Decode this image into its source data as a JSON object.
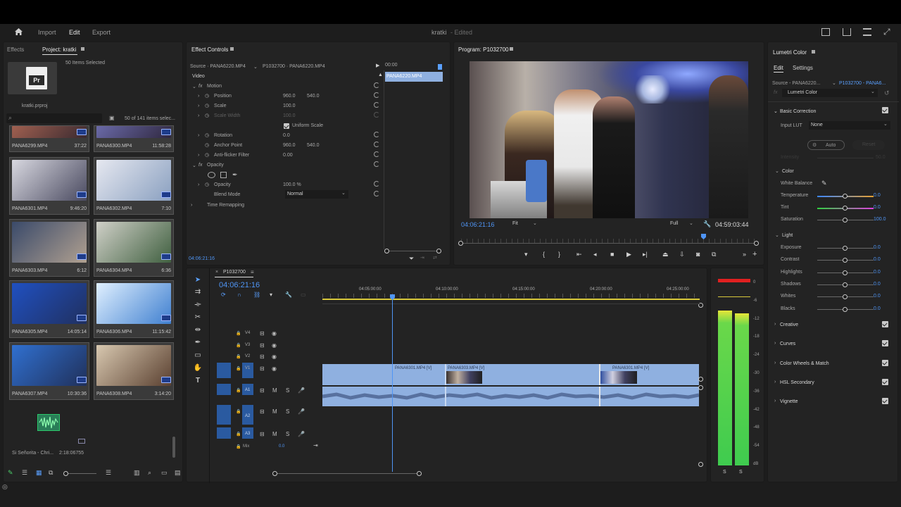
{
  "header": {
    "menu": [
      "Import",
      "Edit",
      "Export"
    ],
    "active": "Edit",
    "project_title": "kratki",
    "project_state": "- Edited"
  },
  "project_panel": {
    "tabs": [
      "Effects",
      "Project: kratki"
    ],
    "selection_info": "50 Items Selected",
    "project_file": "kratki.prproj",
    "items_count": "50 of 141 items selec...",
    "thumbs": [
      {
        "name": "PANA6299.MP4",
        "dur": "37:22",
        "c1": "#a06050",
        "c2": "#3a2a30"
      },
      {
        "name": "PANA6300.MP4",
        "dur": "11:58:28",
        "c1": "#6a6aa8",
        "c2": "#302840"
      },
      {
        "name": "PANA6301.MP4",
        "dur": "9:46:20",
        "c1": "#d8d8e0",
        "c2": "#4a4a60"
      },
      {
        "name": "PANA6302.MP4",
        "dur": "7:10",
        "c1": "#e6e8f0",
        "c2": "#8aa0c0"
      },
      {
        "name": "PANA6303.MP4",
        "dur": "6:12",
        "c1": "#3a4a6a",
        "c2": "#b0a090"
      },
      {
        "name": "PANA6304.MP4",
        "dur": "6:36",
        "c1": "#d0d0c8",
        "c2": "#406040"
      },
      {
        "name": "PANA6305.MP4",
        "dur": "14:05:14",
        "c1": "#2050c0",
        "c2": "#203060"
      },
      {
        "name": "PANA6306.MP4",
        "dur": "11:15:42",
        "c1": "#e0f0ff",
        "c2": "#4080d0"
      },
      {
        "name": "PANA6307.MP4",
        "dur": "10:30:36",
        "c1": "#3070d0",
        "c2": "#20305a"
      },
      {
        "name": "PANA6308.MP4",
        "dur": "3:14:20",
        "c1": "#d8c8b0",
        "c2": "#5a4030"
      }
    ],
    "audio_item": {
      "name": "Si Señorita - Chri...",
      "dur": "2:18:06755"
    }
  },
  "effect_controls": {
    "tab": "Effect Controls",
    "source": "Source · PANA6220.MP4",
    "sequence_clip": "P1032700 · PANA6220.MP4",
    "timecode_head": "00:00",
    "clip_name": "PANA6220.MP4",
    "video_label": "Video",
    "motion": "Motion",
    "position_label": "Position",
    "position_x": "960.0",
    "position_y": "540.0",
    "scale_label": "Scale",
    "scale_val": "100.0",
    "scale_width_label": "Scale Width",
    "scale_width_val": "100.0",
    "uniform_scale": "Uniform Scale",
    "rotation_label": "Rotation",
    "rotation_val": "0.0",
    "anchor_label": "Anchor Point",
    "anchor_x": "960.0",
    "anchor_y": "540.0",
    "antiflicker_label": "Anti-flicker Filter",
    "antiflicker_val": "0.00",
    "opacity_section": "Opacity",
    "opacity_label": "Opacity",
    "opacity_val": "100.0 %",
    "blend_label": "Blend Mode",
    "blend_val": "Normal",
    "time_remap": "Time Remapping",
    "current_time": "04:06:21:16"
  },
  "program_monitor": {
    "tab": "Program: P1032700",
    "timecode": "04:06:21:16",
    "fit": "Fit",
    "quality": "Full",
    "duration": "04:59:03:44"
  },
  "timeline": {
    "sequence": "P1032700",
    "timecode": "04:06:21:16",
    "ruler": [
      "04:05:00:00",
      "04:10:00:00",
      "04:15:00:00",
      "04:20:00:00",
      "04:25:00:00"
    ],
    "video_tracks": [
      "V4",
      "V3",
      "V2",
      "V1"
    ],
    "audio_tracks": [
      "A1",
      "A2",
      "A3"
    ],
    "mix_label": "Mix",
    "mix_val": "0.0",
    "clip_labels": [
      "PANA6301.MP4 [V]",
      "PANA6303.MP4 [V]",
      "PANA6301.MP4 [V]"
    ]
  },
  "audio_meter": {
    "scale": [
      "0",
      "-6",
      "-12",
      "-18",
      "-24",
      "-30",
      "-36",
      "-42",
      "-48",
      "-54",
      "dB"
    ],
    "solo": [
      "S",
      "S"
    ]
  },
  "lumetri": {
    "tab": "Lumetri Color",
    "subtabs": [
      "Edit",
      "Settings"
    ],
    "source": "Source - PANA6220...",
    "clip": "P1032700 - PANA6...",
    "effect": "Lumetri Color",
    "basic_correction": "Basic Correction",
    "input_lut_label": "Input LUT",
    "input_lut_val": "None",
    "auto": "Auto",
    "reset": "Reset",
    "intensity": "Intensity",
    "intensity_val": "50.0",
    "color": "Color",
    "white_balance": "White Balance",
    "light": "Light",
    "color_rows": [
      {
        "label": "Temperature",
        "val": "0.0",
        "track": "temp"
      },
      {
        "label": "Tint",
        "val": "0.0",
        "track": "tint"
      },
      {
        "label": "Saturation",
        "val": "100.0",
        "track": "plain"
      }
    ],
    "light_rows": [
      {
        "label": "Exposure",
        "val": "0.0"
      },
      {
        "label": "Contrast",
        "val": "0.0"
      },
      {
        "label": "Highlights",
        "val": "0.0"
      },
      {
        "label": "Shadows",
        "val": "0.0"
      },
      {
        "label": "Whites",
        "val": "0.0"
      },
      {
        "label": "Blacks",
        "val": "0.0"
      }
    ],
    "sections": [
      "Creative",
      "Curves",
      "Color Wheels & Match",
      "HSL Secondary",
      "Vignette"
    ]
  }
}
